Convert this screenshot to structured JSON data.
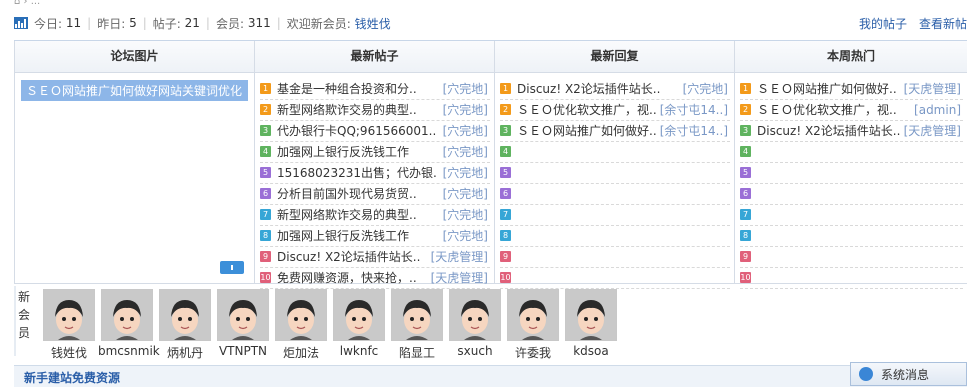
{
  "stats": {
    "today_label": "今日:",
    "today": "11",
    "yesterday_label": "昨日:",
    "yesterday": "5",
    "posts_label": "帖子:",
    "posts": "21",
    "members_label": "会员:",
    "members": "311",
    "welcome_label": "欢迎新会员:",
    "newest_member": "钱姓伐",
    "my_posts": "我的帖子",
    "view_new": "查看新帖"
  },
  "columns": {
    "pics": "论坛图片",
    "new_posts": "最新帖子",
    "new_replies": "最新回复",
    "hot": "本周热门"
  },
  "pic_item": "ＳＥＯ网站推广如何做好网站关键词优化",
  "new_posts": [
    {
      "n": "1",
      "t": "基金是一种组合投资和分..",
      "a": "[穴完地]"
    },
    {
      "n": "2",
      "t": "新型网络欺诈交易的典型..",
      "a": "[穴完地]"
    },
    {
      "n": "3",
      "t": "代办银行卡QQ;961566001..",
      "a": "[穴完地]"
    },
    {
      "n": "4",
      "t": "加强网上银行反洗钱工作",
      "a": "[穴完地]"
    },
    {
      "n": "5",
      "t": "15168023231出售；代办银..",
      "a": "[穴完地]"
    },
    {
      "n": "6",
      "t": "分析目前国外现代易货贸..",
      "a": "[穴完地]"
    },
    {
      "n": "7",
      "t": "新型网络欺诈交易的典型..",
      "a": "[穴完地]"
    },
    {
      "n": "8",
      "t": "加强网上银行反洗钱工作",
      "a": "[穴完地]"
    },
    {
      "n": "9",
      "t": "Discuz! X2论坛插件站长..",
      "a": "[天虎管理]"
    },
    {
      "n": "10",
      "t": "免费网赚资源，快来抢，..",
      "a": "[天虎管理]"
    }
  ],
  "new_replies": [
    {
      "n": "1",
      "t": "Discuz! X2论坛插件站长..",
      "a": "[穴完地]"
    },
    {
      "n": "2",
      "t": "ＳＥＯ优化软文推广，视..",
      "a": "[余寸屯14..]"
    },
    {
      "n": "3",
      "t": "ＳＥＯ网站推广如何做好..",
      "a": "[余寸屯14..]"
    },
    {
      "n": "4",
      "t": "",
      "a": ""
    },
    {
      "n": "5",
      "t": "",
      "a": ""
    },
    {
      "n": "6",
      "t": "",
      "a": ""
    },
    {
      "n": "7",
      "t": "",
      "a": ""
    },
    {
      "n": "8",
      "t": "",
      "a": ""
    },
    {
      "n": "9",
      "t": "",
      "a": ""
    },
    {
      "n": "10",
      "t": "",
      "a": ""
    }
  ],
  "hot": [
    {
      "n": "1",
      "t": "ＳＥＯ网站推广如何做好..",
      "a": "[天虎管理]"
    },
    {
      "n": "2",
      "t": "ＳＥＯ优化软文推广，视..",
      "a": "[admin]"
    },
    {
      "n": "3",
      "t": "Discuz! X2论坛插件站长..",
      "a": "[天虎管理]"
    },
    {
      "n": "4",
      "t": "",
      "a": ""
    },
    {
      "n": "5",
      "t": "",
      "a": ""
    },
    {
      "n": "6",
      "t": "",
      "a": ""
    },
    {
      "n": "7",
      "t": "",
      "a": ""
    },
    {
      "n": "8",
      "t": "",
      "a": ""
    },
    {
      "n": "9",
      "t": "",
      "a": ""
    },
    {
      "n": "10",
      "t": "",
      "a": ""
    }
  ],
  "new_members_label": "新会员",
  "new_members": [
    "钱姓伐",
    "bmcsnmik",
    "炳机丹",
    "VTNPTN",
    "炬加法",
    "lwknfc",
    "陷显工",
    "sxuch",
    "许委我",
    "kdsoa"
  ],
  "bottom_title": "新手建站免费资源",
  "system_msg": "系统消息",
  "colors": {
    "accent": "#2a5ea8",
    "num": [
      "#f39a1a",
      "#f39a1a",
      "#5fb35f",
      "#5fb35f",
      "#9a6fd6",
      "#9a6fd6",
      "#36a6d6",
      "#36a6d6",
      "#e0607a",
      "#e0607a"
    ]
  }
}
